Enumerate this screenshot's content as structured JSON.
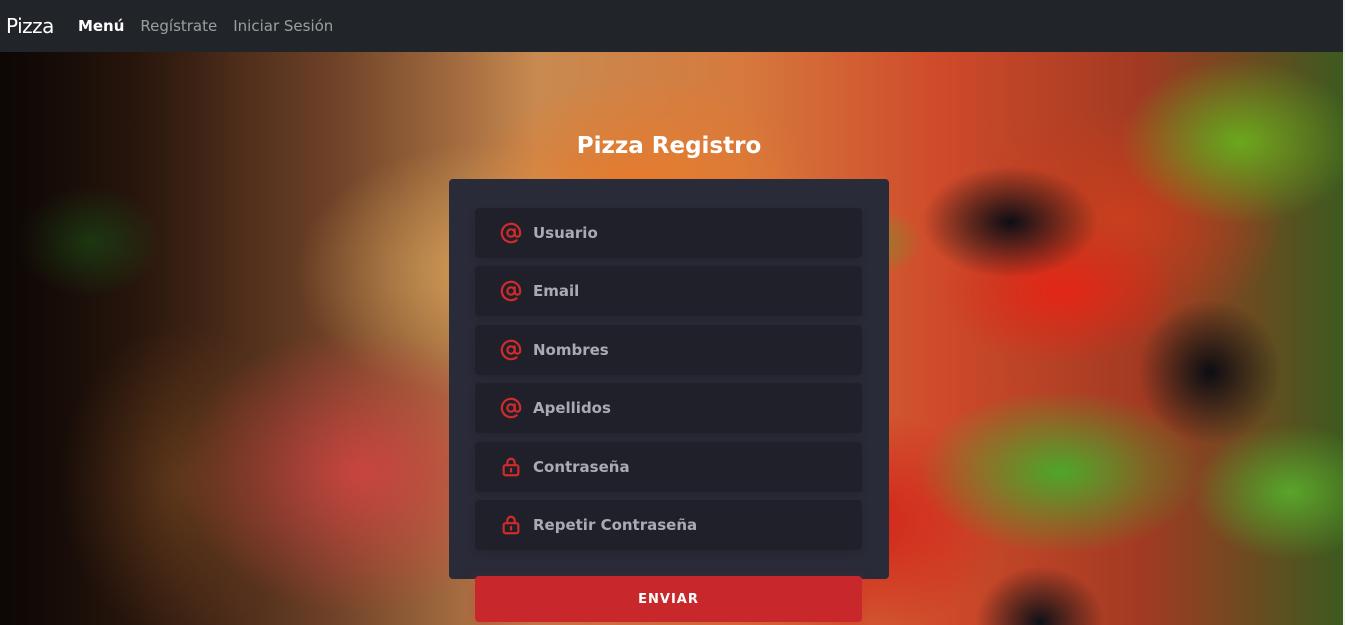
{
  "navbar": {
    "brand": "Pizza",
    "links": [
      {
        "label": "Menú",
        "active": true
      },
      {
        "label": "Regístrate",
        "active": false
      },
      {
        "label": "Iniciar Sesión",
        "active": false
      }
    ]
  },
  "form": {
    "title": "Pizza Registro",
    "fields": [
      {
        "placeholder": "Usuario",
        "icon": "at-icon"
      },
      {
        "placeholder": "Email",
        "icon": "at-icon"
      },
      {
        "placeholder": "Nombres",
        "icon": "at-icon"
      },
      {
        "placeholder": "Apellidos",
        "icon": "at-icon"
      },
      {
        "placeholder": "Contraseña",
        "icon": "lock-icon"
      },
      {
        "placeholder": "Repetir Contraseña",
        "icon": "lock-icon"
      }
    ],
    "submit_label": "ENVIAR"
  },
  "colors": {
    "navbar": "#212529",
    "card": "#2a2b38",
    "field": "#1f2029",
    "accent": "#c8282b",
    "icon": "#d02b2b"
  }
}
